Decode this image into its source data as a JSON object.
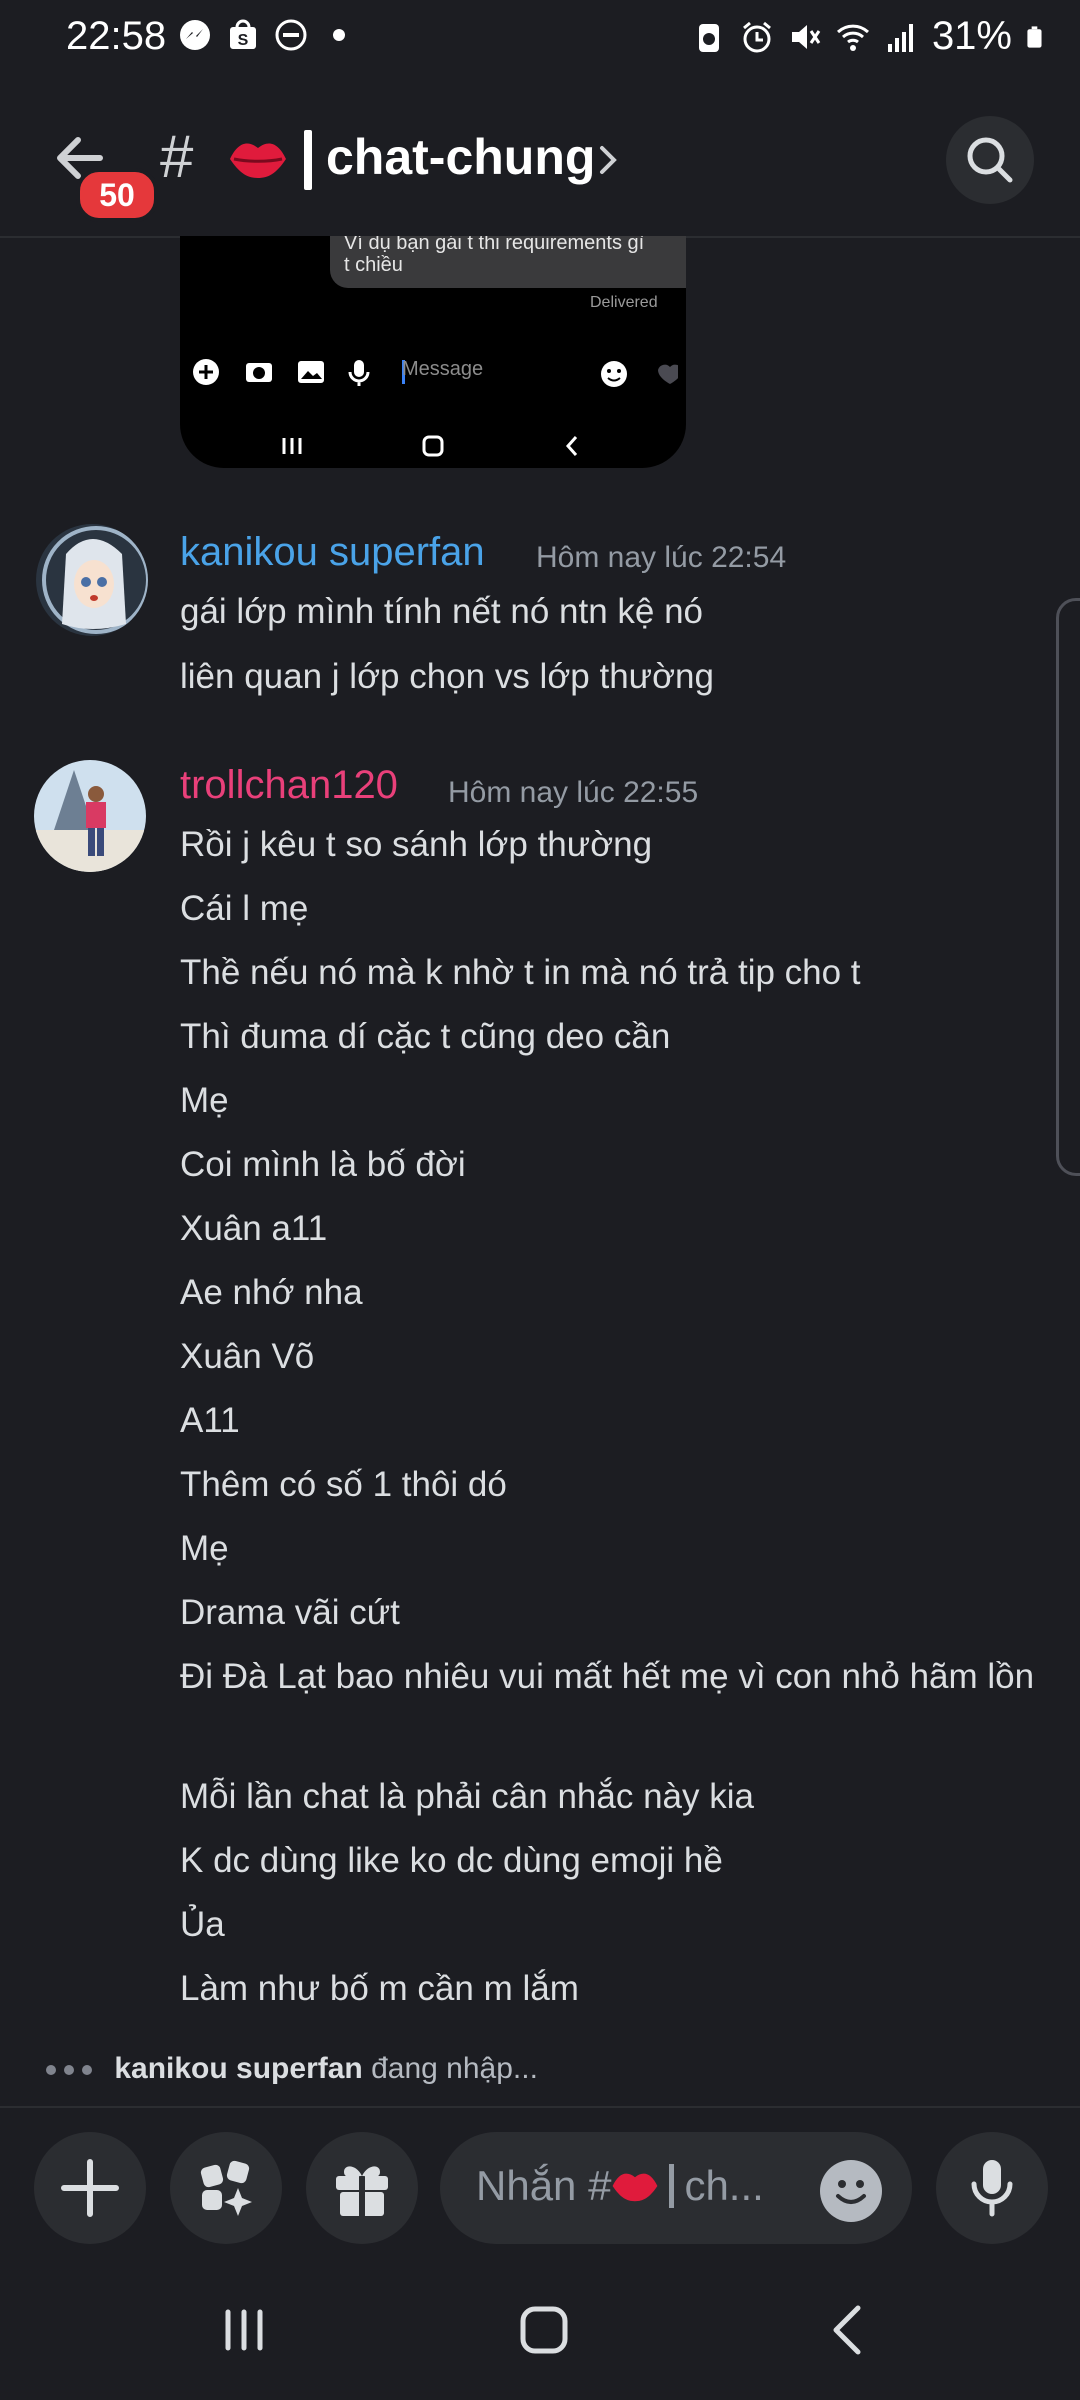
{
  "status_bar": {
    "time": "22:58",
    "battery": "31%",
    "left_icons": [
      "messenger-icon",
      "shopee-icon",
      "dnd-icon",
      "dot-icon"
    ],
    "right_icons": [
      "battery-saver-icon",
      "alarm-icon",
      "mute-icon",
      "wifi-icon",
      "signal-icon",
      "battery-icon"
    ]
  },
  "header": {
    "unread_badge": "50",
    "hash": "#",
    "channel_name": "chat-chung"
  },
  "embedded_screenshot": {
    "bubble_line1": "Ví dụ bạn gái t thi requirements gì",
    "bubble_line2": "t chiều",
    "delivered": "Delivered",
    "message_placeholder": "Message"
  },
  "messages": [
    {
      "author": "kanikou superfan",
      "author_color": "#4aa3e8",
      "timestamp": "Hôm nay lúc 22:54",
      "lines": [
        "gái lớp mình tính nết nó ntn kệ nó",
        "liên quan j lớp chọn vs lớp thường"
      ]
    },
    {
      "author": "trollchan120",
      "author_color": "#e9407a",
      "timestamp": "Hôm nay lúc 22:55",
      "lines": [
        "Rồi j kêu t so sánh lớp thường",
        "Cái l mẹ",
        "Thề nếu nó mà k nhờ t in mà nó trả tip cho t",
        "Thì đuma dí cặc t cũng deo cần",
        "Mẹ",
        "Coi mình là bố đời",
        "Xuân a11",
        "Ae nhớ nha",
        "Xuân Võ",
        "A11",
        "Thêm có số 1 thôi dó",
        "Mẹ",
        "Drama vãi cứt",
        "Đi Đà Lạt bao nhiêu vui mất hết mẹ vì con nhỏ hãm lồn",
        "Mỗi lần chat là phải cân nhắc này kia",
        "K dc dùng like ko dc dùng emoji hề",
        "Ủa",
        "Làm như bố m cần m lắm"
      ]
    }
  ],
  "typing": {
    "user": "kanikou superfan",
    "suffix": "đang nhập..."
  },
  "composer": {
    "placeholder_prefix": "Nhắn #",
    "placeholder_suffix": "ch..."
  }
}
